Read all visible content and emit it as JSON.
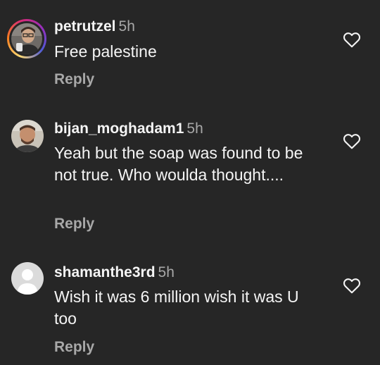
{
  "comments": [
    {
      "username": "petrutzel",
      "time": "5h",
      "text": "Free palestine",
      "reply_label": "Reply",
      "avatar_icon": "user-photo-icon"
    },
    {
      "username": "bijan_moghadam1",
      "time": "5h",
      "text": "Yeah but the soap was found to be not true. Who woulda thought....",
      "reply_label": "Reply",
      "avatar_icon": "user-photo-icon"
    },
    {
      "username": "shamanthe3rd",
      "time": "5h",
      "text": "Wish it was 6 million wish it was U too",
      "reply_label": "Reply",
      "avatar_icon": "default-avatar-icon"
    }
  ],
  "colors": {
    "background": "#262626",
    "primary_text": "#f5f5f5",
    "secondary_text": "#a8a8a8"
  }
}
